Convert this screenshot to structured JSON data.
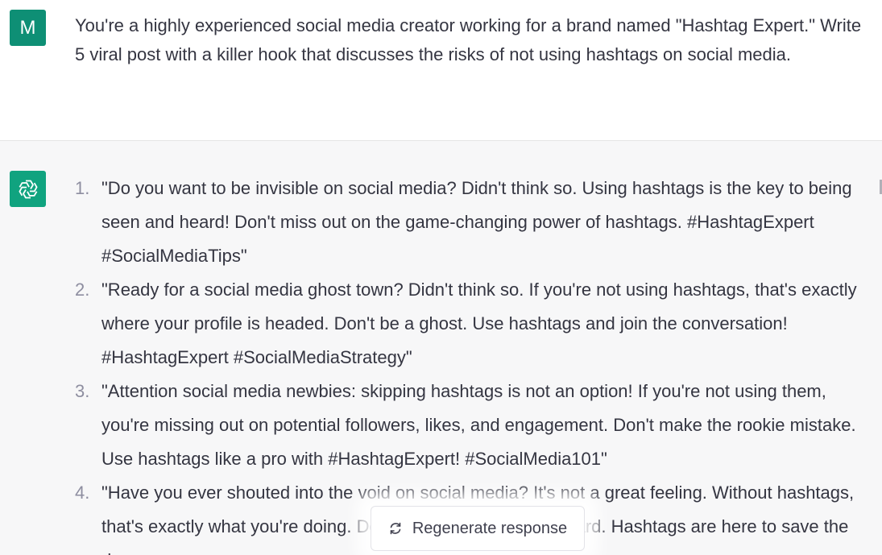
{
  "user": {
    "avatar_letter": "M",
    "message": "You're a highly experienced social media creator working for a brand named \"Hashtag Expert.\" Write 5 viral post with a killer hook that discusses the risks of not using hashtags on social media."
  },
  "assistant": {
    "avatar_icon": "openai-logo-icon",
    "items": [
      {
        "number": "1.",
        "text": "\"Do you want to be invisible on social media? Didn't think so. Using hashtags is the key to being seen and heard! Don't miss out on the game-changing power of hashtags. #HashtagExpert #SocialMediaTips\""
      },
      {
        "number": "2.",
        "text": "\"Ready for a social media ghost town? Didn't think so. If you're not using hashtags, that's exactly where your profile is headed. Don't be a ghost. Use hashtags and join the conversation! #HashtagExpert #SocialMediaStrategy\""
      },
      {
        "number": "3.",
        "text": "\"Attention social media newbies: skipping hashtags is not an option! If you're not using them, you're missing out on potential followers, likes, and engagement. Don't make the rookie mistake. Use hashtags like a pro with #HashtagExpert! #SocialMedia101\""
      },
      {
        "number": "4.",
        "text": "\"Have you ever shouted into the void on social media? It's not a great feeling. Without hashtags, that's exactly what you're doing. Don't let your voice go unheard. Hashtags are here to save the day."
      }
    ]
  },
  "regenerate": {
    "label": "Regenerate response",
    "icon": "refresh-icon"
  },
  "colors": {
    "user_avatar": "#0e8f75",
    "assistant_avatar": "#10a37f",
    "assistant_bg": "#f7f7f8"
  }
}
